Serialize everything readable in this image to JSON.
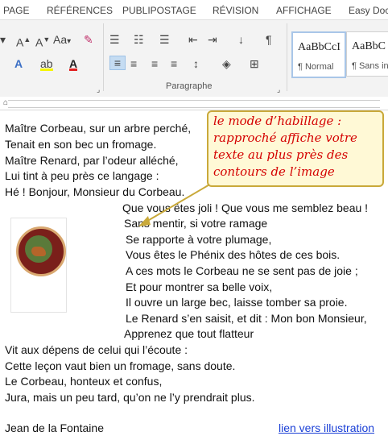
{
  "menu": [
    "PAGE",
    "RÉFÉRENCES",
    "PUBLIPOSTAGE",
    "RÉVISION",
    "AFFICHAGE",
    "Easy Doc"
  ],
  "ribbon": {
    "font_size_label": "Aa",
    "paragraph_label": "Paragraphe",
    "styles": [
      {
        "sample": "AaBbCcI",
        "name": "¶ Normal"
      },
      {
        "sample": "AaBbC",
        "name": "¶ Sans in"
      }
    ],
    "pilcrow": "¶"
  },
  "callout": {
    "lines": [
      "le mode d’habillage :",
      "rapproché affiche votre",
      "texte au plus près des",
      "contours de l’image"
    ]
  },
  "document": {
    "lines": [
      "Maître Corbeau, sur un arbre perché,",
      "Tenait en son bec un fromage.",
      "Maître Renard, par l’odeur alléché,",
      "Lui tint à peu près ce langage :",
      "Hé ! Bonjour, Monsieur du Corbeau.",
      "Que vous êtes joli !  Que vous me semblez beau !",
      "Sans mentir, si votre ramage",
      "Se rapporte à votre plumage,",
      "Vous êtes le Phénix des hôtes de ces bois.",
      "A ces mots le Corbeau ne se sent pas de joie ;",
      "Et pour montrer sa belle voix,",
      "Il ouvre un large bec, laisse tomber sa proie.",
      "Le Renard s’en saisit, et dit : Mon bon Monsieur,",
      "Apprenez que tout flatteur",
      "Vit aux dépens de celui qui l’écoute :",
      "Cette leçon vaut bien un fromage, sans doute.",
      "Le Corbeau, honteux et confus,",
      "Jura, mais un peu tard, qu’on ne l’y prendrait plus."
    ],
    "author": "Jean de la Fontaine",
    "link_text": "lien vers illustration"
  }
}
